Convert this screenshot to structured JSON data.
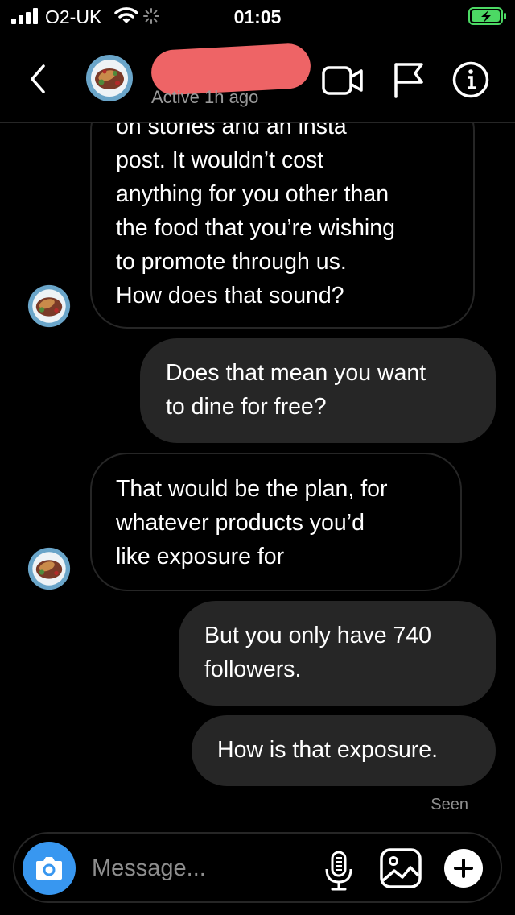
{
  "status_bar": {
    "carrier": "O2-UK",
    "time": "01:05",
    "battery_state": "charging"
  },
  "header": {
    "status": "Active 1h ago",
    "icons": [
      "back-icon",
      "video-call-icon",
      "flag-icon",
      "info-icon"
    ]
  },
  "messages": [
    {
      "direction": "received",
      "text": "on stories and an insta post. It wouldn’t cost anything for you other than the food that you’re wishing to promote through us. How does that sound?",
      "lines": [
        "on stories and an insta",
        "post. It wouldn’t cost",
        "anything for you other than",
        "the food that you’re wishing",
        "to promote through us.",
        "How does that sound?"
      ]
    },
    {
      "direction": "sent",
      "text": "Does that mean you want to dine for free?",
      "lines": [
        "Does that mean you want",
        "to dine for free?"
      ]
    },
    {
      "direction": "received",
      "text": "That would be the plan, for whatever products you’d like exposure for",
      "lines": [
        "That would be the plan, for",
        "whatever products you’d",
        "like exposure for"
      ]
    },
    {
      "direction": "sent",
      "text": "But you only have 740 followers.",
      "lines": [
        "But you only have 740",
        "followers."
      ]
    },
    {
      "direction": "sent",
      "text": "How is that exposure.",
      "lines": [
        "How is that exposure."
      ]
    }
  ],
  "seen_label": "Seen",
  "composer": {
    "placeholder": "Message...",
    "value": ""
  },
  "colors": {
    "background": "#000000",
    "sent_bubble": "#262626",
    "received_border": "#262626",
    "camera_button": "#3897f0",
    "redaction": "#ee6466",
    "battery_charging": "#4cd964"
  }
}
